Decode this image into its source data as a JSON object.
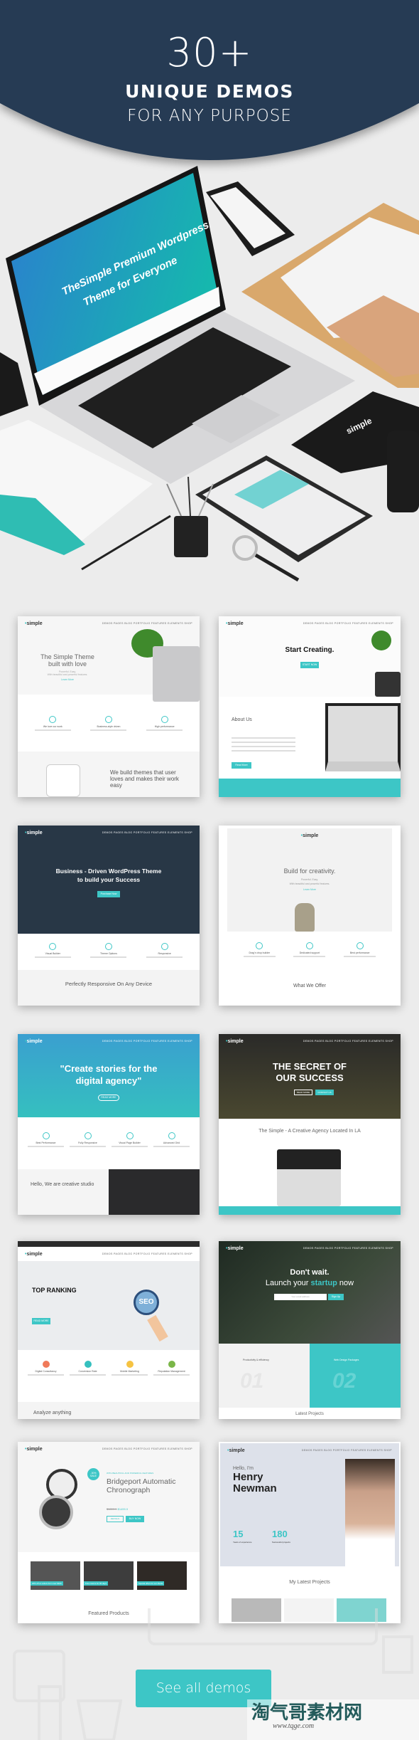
{
  "header": {
    "count": "30+",
    "title": "UNIQUE DEMOS",
    "subtitle": "FOR ANY PURPOSE",
    "bg_color": "#263b54"
  },
  "scene": {
    "laptop_headline_1": "TheSimple Premium Wordpress",
    "laptop_headline_2": "Theme for Everyone",
    "brand": "simple",
    "brand_prefix": "the"
  },
  "nav_links": "DEMOS   PAGES   BLOG   PORTFOLIO   FEATURES   ELEMENTS   SHOP",
  "thumbs": [
    {
      "title_1": "The Simple Theme",
      "title_2": "built with love",
      "sub_1": "Powerful. Easy.",
      "sub_2": "With beautiful and powerful features.",
      "link": "Learn More",
      "features": [
        "We love our work",
        "Business-style driven",
        "High performance"
      ],
      "bottom": "We build themes that user loves and makes their work easy"
    },
    {
      "title": "Start Creating.",
      "button": "START NOW",
      "section": "About Us",
      "button2": "Read More"
    },
    {
      "title_1": "Business - Driven WordPress Theme",
      "title_2": "to build your Success",
      "button": "Purchase Now",
      "features": [
        "Visual Builder",
        "Theme Options",
        "Responsive"
      ],
      "section": "Perfectly Responsive On Any Device"
    },
    {
      "title": "Build for creativity.",
      "sub_1": "Powerful. Easy.",
      "sub_2": "With beautiful and powerful features.",
      "link": "Learn More",
      "features": [
        "Drag'n drop builder",
        "Dedicated support",
        "Best performance"
      ],
      "section": "What We Offer"
    },
    {
      "title_1": "\"Create stories for the",
      "title_2": "digital agency\"",
      "button": "READ MORE",
      "features": [
        "Best Performance",
        "Fully Responsive",
        "Visual Page Builder",
        "Advanced Grid"
      ],
      "section": "Hello, We are creative studio"
    },
    {
      "title_1": "THE SECRET OF",
      "title_2": "OUR SUCCESS",
      "button": "READ MORE",
      "button2": "CONTACT US",
      "section": "The Simple - A Creative Agency Located In LA"
    },
    {
      "title": "TOP RANKING",
      "badge": "SEO",
      "button": "READ MORE",
      "features": [
        "Digital Consultancy",
        "Conversion Rate",
        "Mobile Marketing",
        "Reputation Management"
      ],
      "section": "Analyze anything"
    },
    {
      "title_1": "Don't wait.",
      "title_2a": "Launch your ",
      "title_2b": "startup",
      "title_2c": " now",
      "input_placeholder": "Your email address",
      "button": "Sign Up",
      "features": [
        "Productivity & efficiency",
        "Web Design Packages"
      ],
      "numbers": [
        "01",
        "02"
      ],
      "section": "Latest Projects"
    },
    {
      "kicker": "WITH BEAUTIFUL AND POWERFUL FEATURES",
      "title_1": "Bridgeport Automatic",
      "title_2": "Chronograph",
      "old_price": "$1899.9",
      "price": "$1499.9",
      "badge": "-30% SALE",
      "button": "DETAILS",
      "button2": "BUY NOW",
      "banners": [
        "20% off on orders from over $100",
        "Free returns for 30 days",
        "Special offers for our clients"
      ],
      "section": "Featured Products"
    },
    {
      "greeting": "Hello, I'm",
      "name_1": "Henry",
      "name_2": "Newman",
      "stat_1": "15",
      "stat_1_label": "Years of experience",
      "stat_2": "180",
      "stat_2_label": "Successful projects",
      "section": "My Latest Projects"
    }
  ],
  "cta": {
    "label": "See all demos",
    "color": "#3dc6c6"
  },
  "watermark": {
    "text": "淘气哥素材网",
    "url": "www.tqge.com"
  }
}
